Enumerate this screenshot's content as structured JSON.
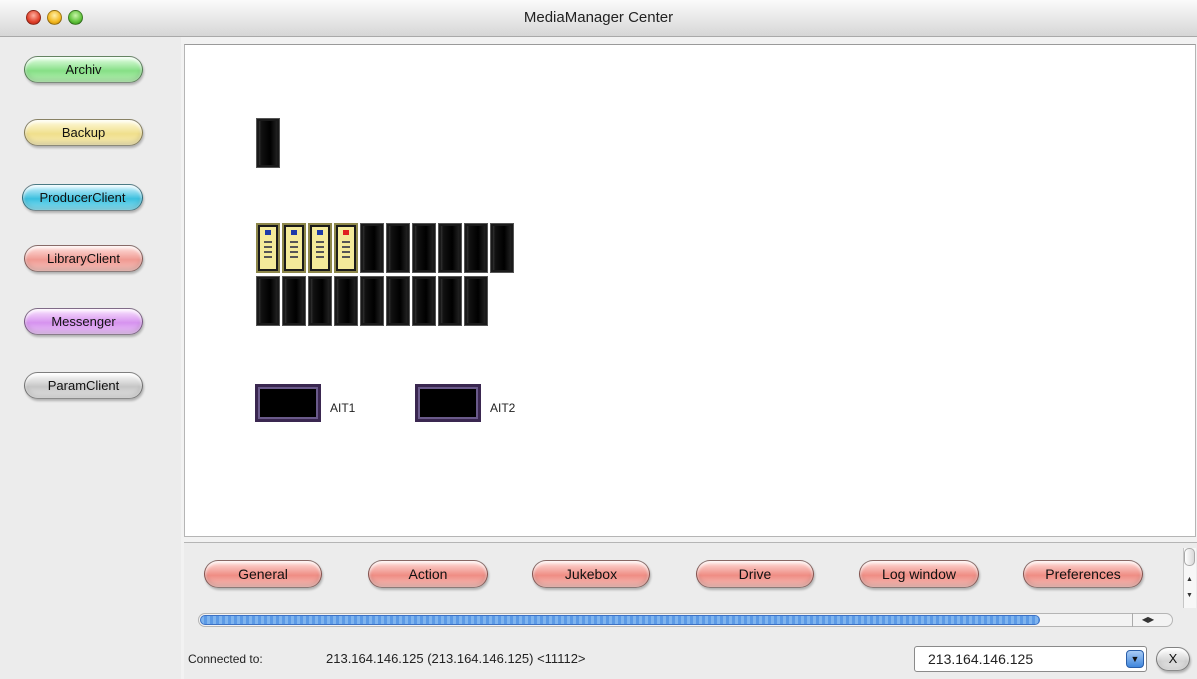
{
  "window": {
    "title": "MediaManager Center"
  },
  "sidebar": {
    "items": [
      {
        "label": "Archiv"
      },
      {
        "label": "Backup"
      },
      {
        "label": "ProducerClient"
      },
      {
        "label": "LibraryClient"
      },
      {
        "label": "Messenger"
      },
      {
        "label": "ParamClient"
      }
    ]
  },
  "library": {
    "tapes_loaded": 4,
    "drives": [
      {
        "label": "AIT1"
      },
      {
        "label": "AIT2"
      }
    ]
  },
  "toolbar": {
    "buttons": [
      {
        "label": "General"
      },
      {
        "label": "Action"
      },
      {
        "label": "Jukebox"
      },
      {
        "label": "Drive"
      },
      {
        "label": "Log window"
      },
      {
        "label": "Preferences"
      }
    ]
  },
  "status": {
    "label": "Connected to:",
    "connection": "213.164.146.125 (213.164.146.125) <11112>",
    "server_select": "213.164.146.125",
    "close_label": "X"
  },
  "colors": {
    "accent": "#3c71c4"
  }
}
